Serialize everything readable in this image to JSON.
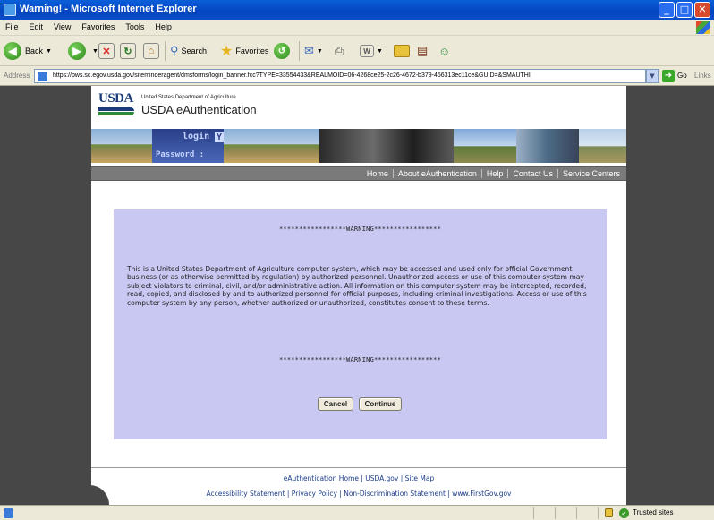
{
  "window": {
    "title": "Warning! - Microsoft Internet Explorer",
    "minimize_glyph": "_",
    "maximize_glyph": "□",
    "close_glyph": "✕"
  },
  "menu": [
    "File",
    "Edit",
    "View",
    "Favorites",
    "Tools",
    "Help"
  ],
  "toolbar": {
    "back_label": "Back",
    "search_label": "Search",
    "favorites_label": "Favorites"
  },
  "address": {
    "label": "Address",
    "url": "https://pws.sc.egov.usda.gov/siteminderagent/dmsforms/login_banner.fcc?TYPE=33554433&REALMOID=06-4268ce25-2c26-4672-b379-466313ec11ce&GUID=&SMAUTHI",
    "go_label": "Go",
    "links_label": "Links"
  },
  "header": {
    "logo_text": "USDA",
    "department": "United States Department of Agriculture",
    "site_name": "USDA eAuthentication"
  },
  "banner": {
    "login_text": "login :",
    "password_text": "Password :",
    "field_fragment": "Y"
  },
  "nav": [
    "Home",
    "About eAuthentication",
    "Help",
    "Contact Us",
    "Service Centers"
  ],
  "warning": {
    "top_banner": "*****************WARNING*****************",
    "body": "This is a United States Department of Agriculture computer system, which may be accessed and used only for official Government business (or as otherwise permitted by regulation) by authorized personnel. Unauthorized access or use of this computer system may subject violators to criminal, civil, and/or administrative action. All information on this computer system may be intercepted, recorded, read, copied, and disclosed by and to authorized personnel for official purposes, including criminal investigations. Access or use of this computer system by any person, whether authorized or unauthorized, constitutes consent to these terms.",
    "bottom_banner": "*****************WARNING*****************",
    "cancel_label": "Cancel",
    "continue_label": "Continue"
  },
  "footer": {
    "row1": [
      "eAuthentication Home",
      "USDA.gov",
      "Site Map"
    ],
    "row2": [
      "Accessibility Statement",
      "Privacy Policy",
      "Non-Discrimination Statement",
      "www.FirstGov.gov"
    ],
    "separator": " | "
  },
  "status": {
    "zone": "Trusted sites"
  }
}
